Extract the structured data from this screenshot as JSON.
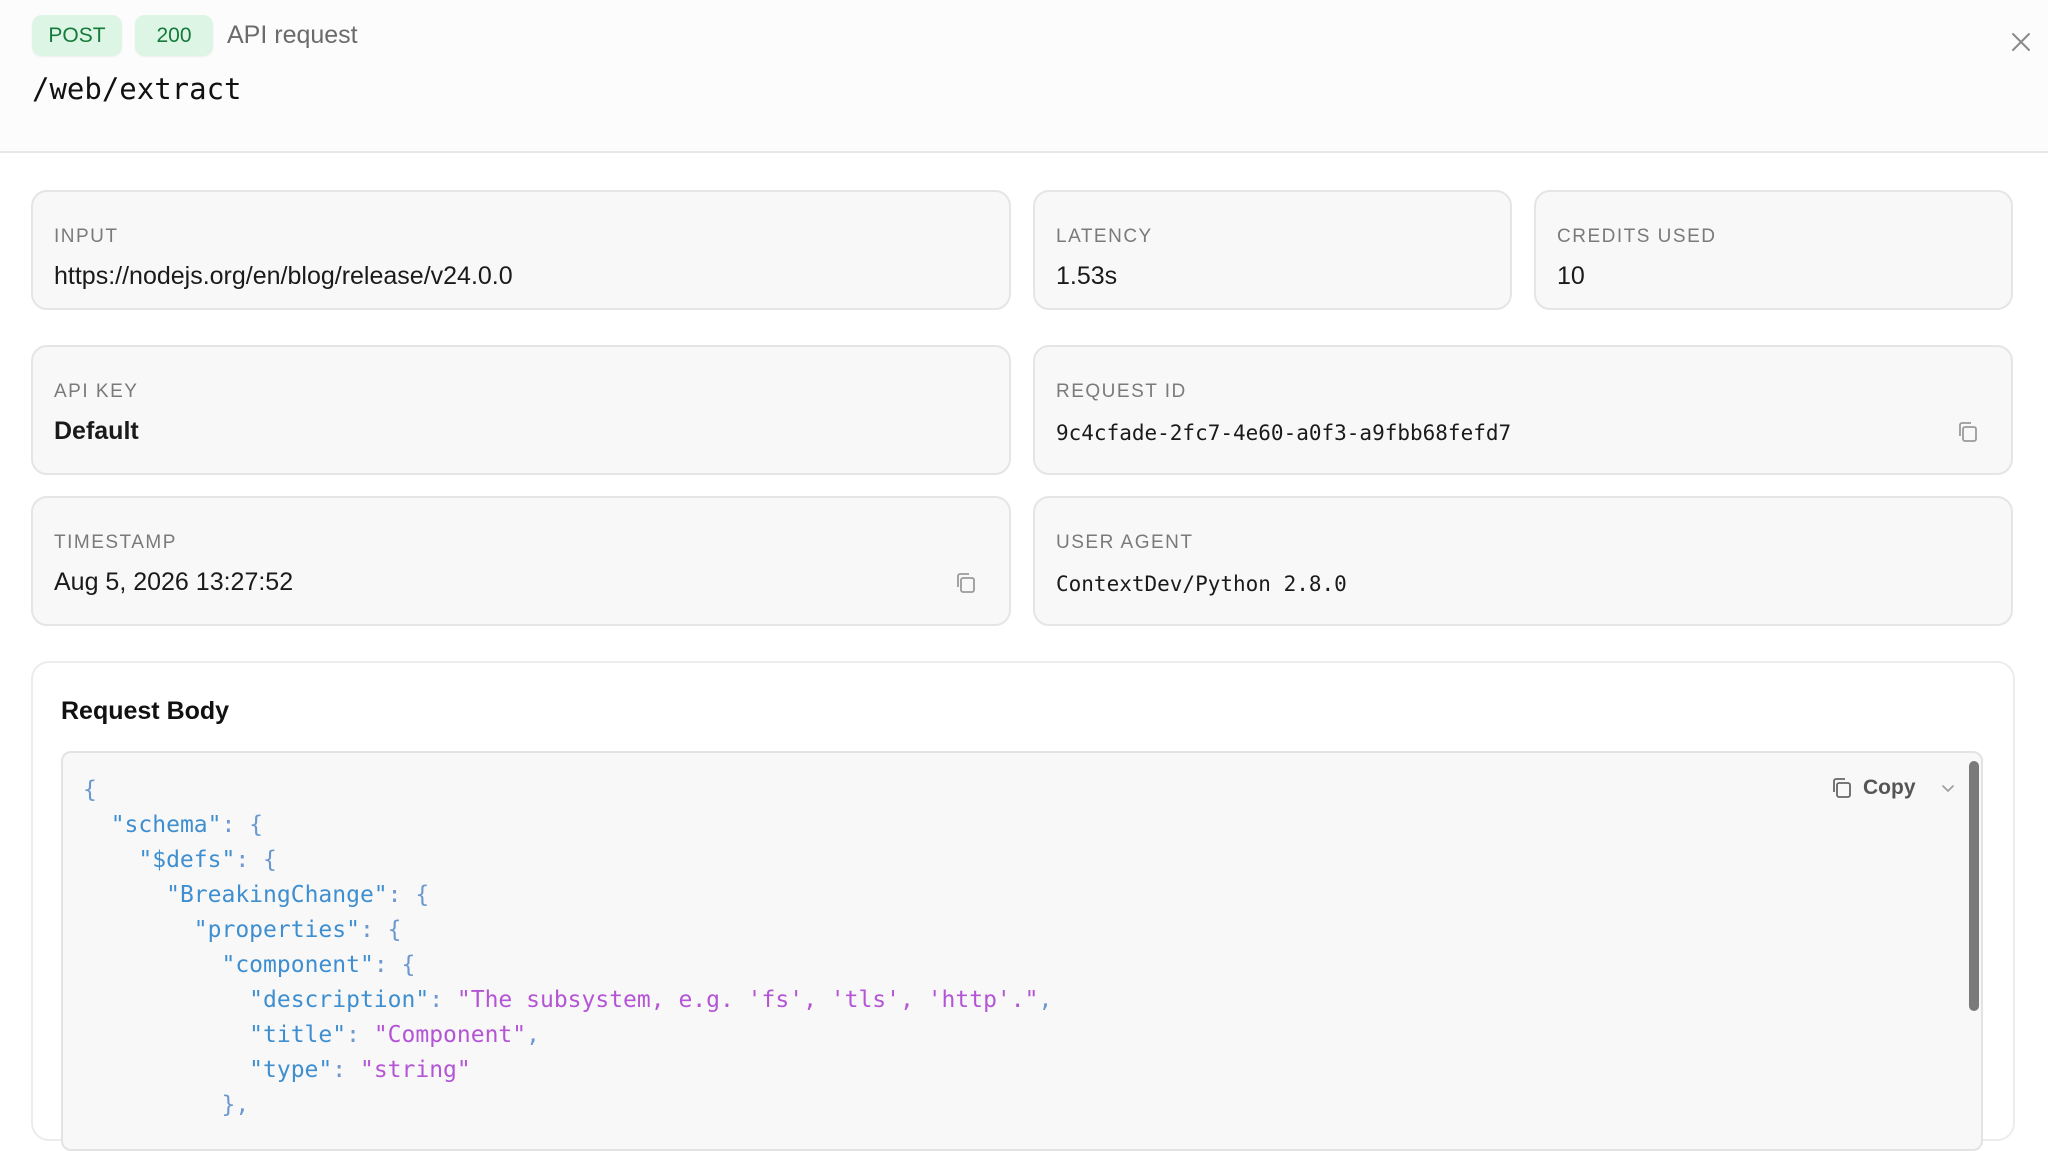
{
  "header": {
    "method": "POST",
    "status": "200",
    "label": "API request",
    "endpoint": "/web/extract",
    "close_icon": "close-icon"
  },
  "cards": {
    "input": {
      "label": "INPUT",
      "value": "https://nodejs.org/en/blog/release/v24.0.0"
    },
    "latency": {
      "label": "LATENCY",
      "value": "1.53s"
    },
    "credits": {
      "label": "CREDITS USED",
      "value": "10"
    },
    "api_key": {
      "label": "API KEY",
      "value": "Default"
    },
    "request_id": {
      "label": "REQUEST ID",
      "value": "9c4cfade-2fc7-4e60-a0f3-a9fbb68fefd7"
    },
    "timestamp": {
      "label": "TIMESTAMP",
      "value": "Aug 5, 2026 13:27:52"
    },
    "user_agent": {
      "label": "USER AGENT",
      "value": "ContextDev/Python 2.8.0"
    }
  },
  "request_body": {
    "title": "Request Body",
    "copy_label": "Copy",
    "lines": [
      [
        {
          "t": "punc",
          "v": "{"
        }
      ],
      [
        {
          "t": "key",
          "v": "\"schema\""
        },
        {
          "t": "punc",
          "v": ": {"
        }
      ],
      [
        {
          "t": "key",
          "v": "\"$defs\""
        },
        {
          "t": "punc",
          "v": ": {"
        }
      ],
      [
        {
          "t": "key",
          "v": "\"BreakingChange\""
        },
        {
          "t": "punc",
          "v": ": {"
        }
      ],
      [
        {
          "t": "key",
          "v": "\"properties\""
        },
        {
          "t": "punc",
          "v": ": {"
        }
      ],
      [
        {
          "t": "key",
          "v": "\"component\""
        },
        {
          "t": "punc",
          "v": ": {"
        }
      ],
      [
        {
          "t": "key",
          "v": "\"description\""
        },
        {
          "t": "punc",
          "v": ": "
        },
        {
          "t": "str",
          "v": "\"The subsystem, e.g. 'fs', 'tls', 'http'.\""
        },
        {
          "t": "punc",
          "v": ","
        }
      ],
      [
        {
          "t": "key",
          "v": "\"title\""
        },
        {
          "t": "punc",
          "v": ": "
        },
        {
          "t": "str",
          "v": "\"Component\""
        },
        {
          "t": "punc",
          "v": ","
        }
      ],
      [
        {
          "t": "key",
          "v": "\"type\""
        },
        {
          "t": "punc",
          "v": ": "
        },
        {
          "t": "str",
          "v": "\"string\""
        }
      ],
      [
        {
          "t": "punc",
          "v": "},"
        }
      ]
    ]
  },
  "colors": {
    "badge_bg": "#dcf5e4",
    "badge_text": "#157a3a",
    "json_key": "#3f8fd0",
    "json_string": "#b455d6"
  }
}
